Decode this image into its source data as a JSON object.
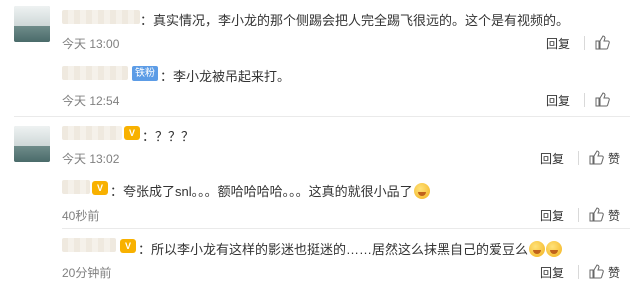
{
  "comments": [
    {
      "text": "：真实情况，李小龙的那个侧踢会把人完全踢飞很远的。这个是有视频的。",
      "time": "今天 13:00",
      "reply_label": "回复",
      "like_label": "",
      "has_avatar": true
    },
    {
      "badge": "铁粉",
      "text": "：李小龙被吊起来打。",
      "time": "今天 12:54",
      "reply_label": "回复",
      "like_label": "",
      "has_avatar": false
    },
    {
      "vip": "V",
      "text": "：？？？",
      "time": "今天 13:02",
      "reply_label": "回复",
      "like_label": "赞",
      "has_avatar": true
    },
    {
      "vip": "V",
      "text": "：夸张成了snl。。。额哈哈哈哈。。。这真的就很小品了",
      "emoji_count": 1,
      "time": "40秒前",
      "reply_label": "回复",
      "like_label": "赞",
      "has_avatar": false
    },
    {
      "vip": "V",
      "text": "：所以李小龙有这样的影迷也挺迷的……居然这么抹黑自己的爱豆么",
      "emoji_count": 2,
      "time": "20分钟前",
      "reply_label": "回复",
      "like_label": "赞",
      "has_avatar": false
    }
  ],
  "icons": {
    "like": "thumbs-up-icon",
    "vip": "vip-badge-icon",
    "emoji": "laughing-emoji-icon"
  },
  "colors": {
    "text": "#333333",
    "meta": "#808080",
    "fan_badge": "#5c9ce6",
    "vip_badge": "#f8b100",
    "divider": "#eaeaea"
  }
}
